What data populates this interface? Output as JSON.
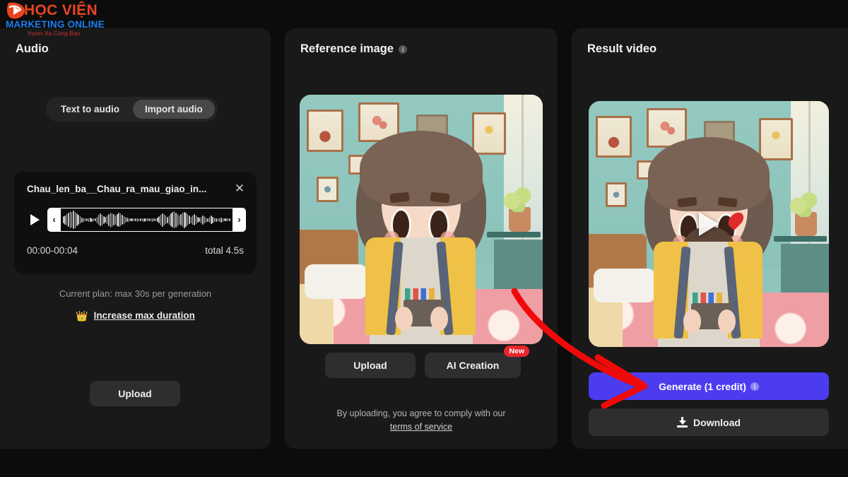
{
  "watermark": {
    "line1": "HỌC VIỆN",
    "line2": "MARKETING ONLINE",
    "line3": "Vươn Xa Cùng Bạn"
  },
  "audio_panel": {
    "title": "Audio",
    "tabs": [
      {
        "label": "Text to audio",
        "active": false
      },
      {
        "label": "Import audio",
        "active": true
      }
    ],
    "file": {
      "name": "Chau_len_ba__Chau_ra_mau_giao_in...",
      "close_icon": "close-icon",
      "play_icon": "play-icon",
      "trim_left_icon": "chevron-left-icon",
      "trim_right_icon": "chevron-right-icon",
      "range": "00:00-00:04",
      "total": "total 4.5s"
    },
    "plan_text": "Current plan: max 30s per generation",
    "upgrade_icon": "crown-icon",
    "upgrade_label": "Increase max duration",
    "upload_label": "Upload"
  },
  "reference_panel": {
    "title": "Reference image",
    "info_icon": "info-icon",
    "info_glyph": "i",
    "upload_label": "Upload",
    "ai_creation_label": "AI Creation",
    "new_badge": "New",
    "terms_text": "By uploading, you agree to comply with our",
    "terms_link": "terms of service"
  },
  "result_panel": {
    "title": "Result video",
    "play_icon": "play-icon",
    "generate_label": "Generate (1 credit)",
    "generate_info_glyph": "i",
    "download_icon": "download-icon",
    "download_label": "Download"
  },
  "colors": {
    "page_background": "#0c0c0c",
    "panel_background": "#191919",
    "accent_generate": "#4b3cf0",
    "badge_red": "#e8262b",
    "annotation_arrow": "#ef0a0a",
    "logo_orange": "#e8451f",
    "logo_blue": "#1a7ff0"
  }
}
